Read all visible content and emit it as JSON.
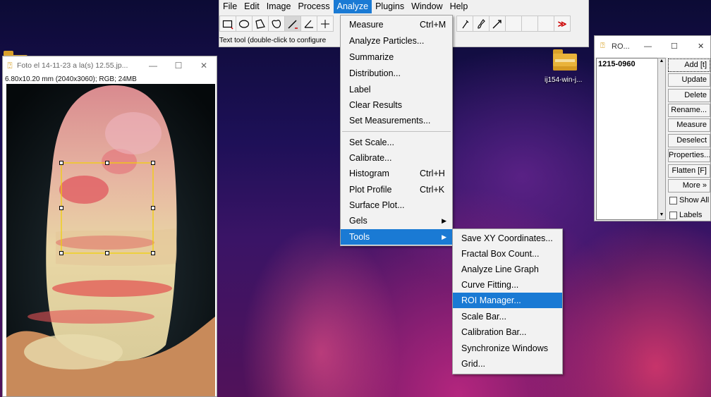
{
  "desktop": {
    "folder1_label": "ij154-win-j..."
  },
  "menubar": {
    "items": [
      "File",
      "Edit",
      "Image",
      "Process",
      "Analyze",
      "Plugins",
      "Window",
      "Help"
    ],
    "active": "Analyze"
  },
  "toolbar": {
    "status": "Text tool (double-click to configure",
    "more_glyph": "≫",
    "tools": [
      "rectangle-tool",
      "oval-tool",
      "polygon-tool",
      "freehand-tool",
      "line-tool",
      "angle-tool",
      "point-tool",
      "dropper-tool",
      "brush-tool",
      "arrow-tool"
    ]
  },
  "image_window": {
    "title": "Foto el 14-11-23 a la(s) 12.55.jp...",
    "info": "6.80x10.20 mm (2040x3060); RGB; 24MB",
    "minimize": "—",
    "maximize": "☐",
    "close": "✕"
  },
  "analyze_menu": {
    "items": [
      {
        "label": "Measure",
        "shortcut": "Ctrl+M"
      },
      {
        "label": "Analyze Particles..."
      },
      {
        "label": "Summarize"
      },
      {
        "label": "Distribution..."
      },
      {
        "label": "Label"
      },
      {
        "label": "Clear Results"
      },
      {
        "label": "Set Measurements..."
      },
      {
        "label": "Set Scale..."
      },
      {
        "label": "Calibrate..."
      },
      {
        "label": "Histogram",
        "shortcut": "Ctrl+H"
      },
      {
        "label": "Plot Profile",
        "shortcut": "Ctrl+K"
      },
      {
        "label": "Surface Plot..."
      },
      {
        "label": "Gels",
        "submenu": true
      },
      {
        "label": "Tools",
        "submenu": true,
        "highlighted": true
      }
    ]
  },
  "tools_submenu": {
    "items": [
      "Save XY Coordinates...",
      "Fractal Box Count...",
      "Analyze Line Graph",
      "Curve Fitting...",
      "ROI Manager...",
      "Scale Bar...",
      "Calibration Bar...",
      "Synchronize Windows",
      "Grid..."
    ],
    "highlighted": "ROI Manager..."
  },
  "roi_manager": {
    "title": "RO...",
    "minimize": "—",
    "maximize": "☐",
    "close": "✕",
    "list_items": [
      "1215-0960"
    ],
    "buttons": [
      "Add [t]",
      "Update",
      "Delete",
      "Rename...",
      "Measure",
      "Deselect",
      "Properties...",
      "Flatten [F]",
      "More »"
    ],
    "show_all": "Show All",
    "labels": "Labels"
  },
  "colors": {
    "menu_highlight": "#1a7ad4",
    "roi_yellow": "#f2d200"
  }
}
